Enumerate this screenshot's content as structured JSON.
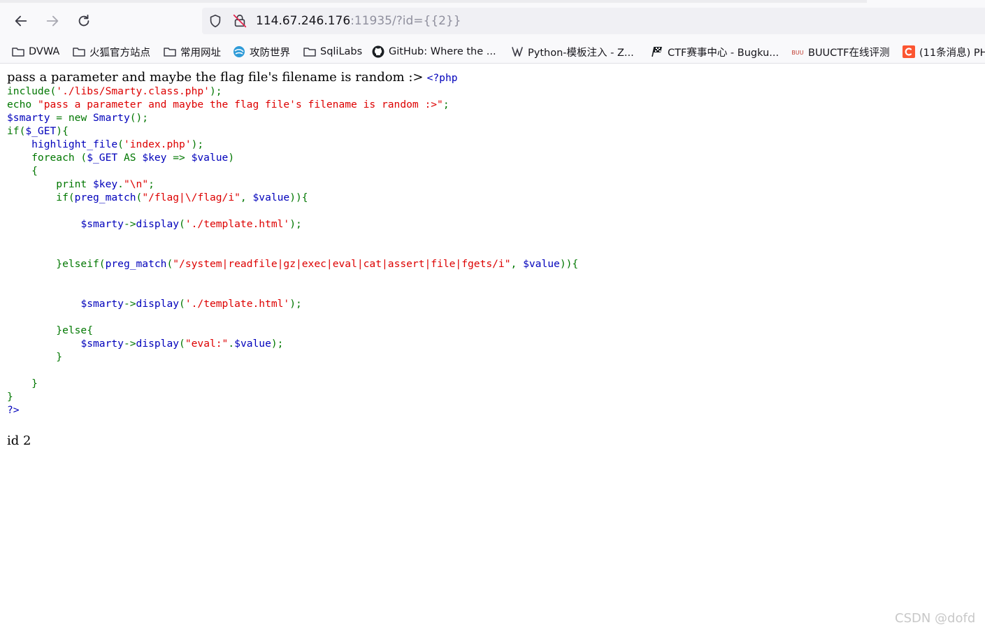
{
  "browser": {
    "url_host": "114.67.246.176",
    "url_rest": ":11935/?id={{2}}",
    "bookmarks": [
      {
        "label": "DVWA",
        "icon": "folder-icon"
      },
      {
        "label": "火狐官方站点",
        "icon": "folder-icon"
      },
      {
        "label": "常用网址",
        "icon": "folder-icon"
      },
      {
        "label": "攻防世界",
        "icon": "globe-icon"
      },
      {
        "label": "SqliLabs",
        "icon": "folder-icon"
      },
      {
        "label": "GitHub: Where the ...",
        "icon": "github-icon"
      },
      {
        "label": "Python-模板注入 - Z...",
        "icon": "fox-icon"
      },
      {
        "label": "CTF赛事中心 - Bugku...",
        "icon": "flag-icon"
      },
      {
        "label": "BUUCTF在线评测",
        "icon": "buu-icon"
      },
      {
        "label": "(11条消息) PH",
        "icon": "csdn-icon"
      }
    ]
  },
  "page": {
    "intro": "pass a parameter and maybe the flag file's filename is random :>",
    "php_open": "<?php",
    "output_line": "id 2",
    "code": [
      [
        [
          "k",
          "include("
        ],
        [
          "s",
          "'./libs/Smarty.class.php'"
        ],
        [
          "k",
          ");"
        ]
      ],
      [
        [
          "k",
          "echo "
        ],
        [
          "s",
          "\"pass a parameter and maybe the flag file's filename is random :>\""
        ],
        [
          "k",
          ";"
        ]
      ],
      [
        [
          "v",
          "$smarty "
        ],
        [
          "k",
          "= new "
        ],
        [
          "v",
          "Smarty"
        ],
        [
          "k",
          "();"
        ]
      ],
      [
        [
          "k",
          "if("
        ],
        [
          "v",
          "$_GET"
        ],
        [
          "k",
          "){"
        ]
      ],
      [
        [
          "k",
          "    "
        ],
        [
          "v",
          "highlight_file"
        ],
        [
          "k",
          "("
        ],
        [
          "s",
          "'index.php'"
        ],
        [
          "k",
          ");"
        ]
      ],
      [
        [
          "k",
          "    foreach ("
        ],
        [
          "v",
          "$_GET "
        ],
        [
          "k",
          "AS "
        ],
        [
          "v",
          "$key "
        ],
        [
          "k",
          "=> "
        ],
        [
          "v",
          "$value"
        ],
        [
          "k",
          ")"
        ]
      ],
      [
        [
          "k",
          "    {"
        ]
      ],
      [
        [
          "k",
          "        print "
        ],
        [
          "v",
          "$key"
        ],
        [
          "k",
          "."
        ],
        [
          "s",
          "\"\\n\""
        ],
        [
          "k",
          ";"
        ]
      ],
      [
        [
          "k",
          "        if("
        ],
        [
          "v",
          "preg_match"
        ],
        [
          "k",
          "("
        ],
        [
          "s",
          "\"/flag|\\/flag/i\""
        ],
        [
          "k",
          ", "
        ],
        [
          "v",
          "$value"
        ],
        [
          "k",
          "))"
        ],
        [
          "k",
          "{"
        ]
      ],
      [
        [
          "k",
          ""
        ]
      ],
      [
        [
          "k",
          "            "
        ],
        [
          "v",
          "$smarty"
        ],
        [
          "k",
          "->"
        ],
        [
          "v",
          "display"
        ],
        [
          "k",
          "("
        ],
        [
          "s",
          "'./template.html'"
        ],
        [
          "k",
          ");"
        ]
      ],
      [
        [
          "k",
          ""
        ]
      ],
      [
        [
          "k",
          ""
        ]
      ],
      [
        [
          "k",
          "        }elseif("
        ],
        [
          "v",
          "preg_match"
        ],
        [
          "k",
          "("
        ],
        [
          "s",
          "\"/system|readfile|gz|exec|eval|cat|assert|file|fgets/i\""
        ],
        [
          "k",
          ", "
        ],
        [
          "v",
          "$value"
        ],
        [
          "k",
          "))"
        ],
        [
          "k",
          "{"
        ]
      ],
      [
        [
          "k",
          ""
        ]
      ],
      [
        [
          "k",
          ""
        ]
      ],
      [
        [
          "k",
          "            "
        ],
        [
          "v",
          "$smarty"
        ],
        [
          "k",
          "->"
        ],
        [
          "v",
          "display"
        ],
        [
          "k",
          "("
        ],
        [
          "s",
          "'./template.html'"
        ],
        [
          "k",
          ");"
        ]
      ],
      [
        [
          "k",
          ""
        ]
      ],
      [
        [
          "k",
          "        }else{"
        ]
      ],
      [
        [
          "k",
          "            "
        ],
        [
          "v",
          "$smarty"
        ],
        [
          "k",
          "->"
        ],
        [
          "v",
          "display"
        ],
        [
          "k",
          "("
        ],
        [
          "s",
          "\"eval:\""
        ],
        [
          "k",
          "."
        ],
        [
          "v",
          "$value"
        ],
        [
          "k",
          ");"
        ]
      ],
      [
        [
          "k",
          "        }"
        ]
      ],
      [
        [
          "k",
          ""
        ]
      ],
      [
        [
          "k",
          "    }"
        ]
      ],
      [
        [
          "k",
          "}"
        ]
      ],
      [
        [
          "v",
          "?>"
        ]
      ]
    ]
  },
  "watermark": "CSDN @dofd"
}
